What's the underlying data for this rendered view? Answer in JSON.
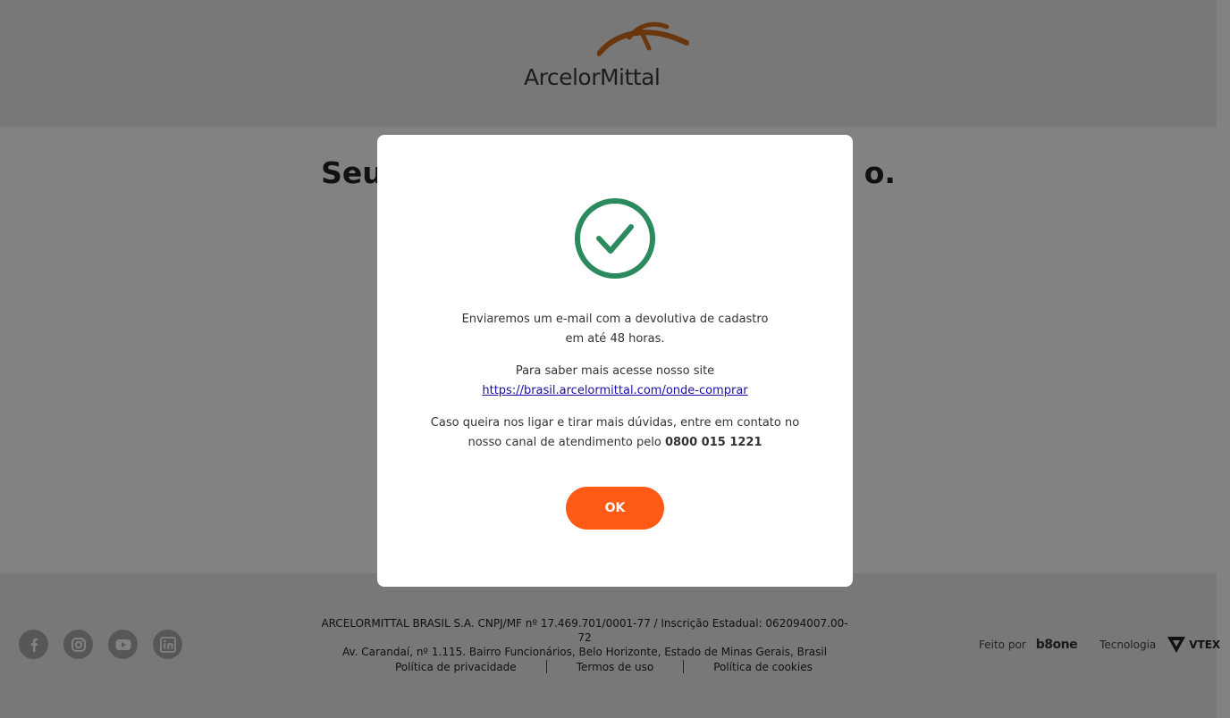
{
  "header": {
    "logo_text": "ArcelorMittal"
  },
  "main": {
    "title_left": "Seu",
    "title_right": "o."
  },
  "modal": {
    "message1_line1": "Enviaremos um e-mail com a devolutiva de cadastro",
    "message1_line2": "em até 48 horas.",
    "message2_line1": "Para saber mais acesse nosso site",
    "site_link": "https://brasil.arcelormittal.com/onde-comprar",
    "message3_line1": "Caso queira nos ligar e tirar mais dúvidas, entre em contato no",
    "message3_line2_prefix": "nosso canal de atendimento pelo ",
    "phone": "0800 015 1221",
    "ok_label": "OK",
    "check_color": "#2b8a5e",
    "button_color": "#ff5a16"
  },
  "footer": {
    "socials": [
      "facebook-icon",
      "instagram-icon",
      "youtube-icon",
      "linkedin-icon"
    ],
    "legal_line1": "ARCELORMITTAL BRASIL S.A. CNPJ/MF nº 17.469.701/0001-77 / Inscrição Estadual: 062094007.00-72",
    "legal_line2": "Av. Carandaí, nº 1.115. Bairro Funcionários, Belo Horizonte, Estado de Minas Gerais, Brasil",
    "links": [
      "Política de privacidade",
      "Termos de uso",
      "Política de cookies"
    ],
    "made_by_label": "Feito por",
    "made_by_brand": "b8one",
    "tech_label": "Tecnologia",
    "tech_brand": "VTEX"
  }
}
